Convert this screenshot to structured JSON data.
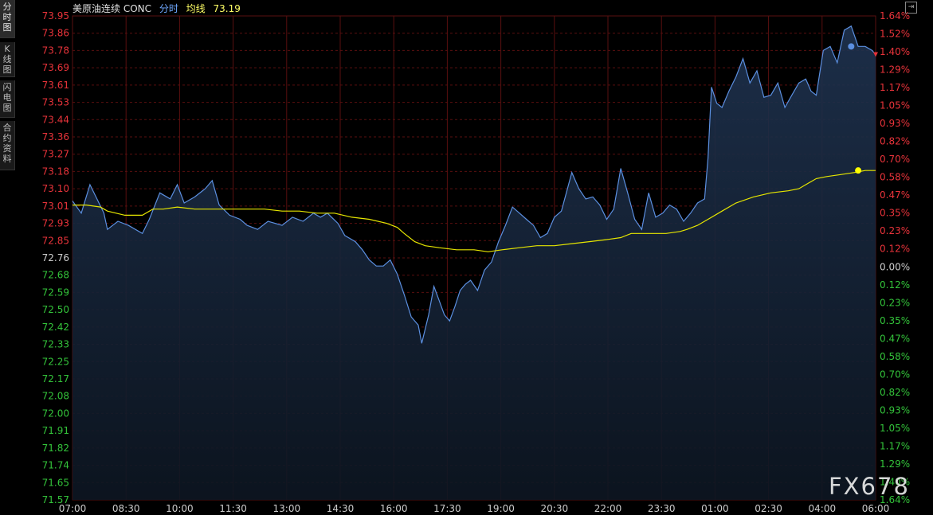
{
  "side_tabs": [
    {
      "label": "分时图",
      "active": true
    },
    {
      "label": "K线图",
      "active": false
    },
    {
      "label": "闪电图",
      "active": false
    },
    {
      "label": "合约资料",
      "active": false
    }
  ],
  "legend": {
    "name": "美原油连续 CONC",
    "minute_label": "分时",
    "avg_label": "均线",
    "avg_value": "73.19"
  },
  "corner_icon": "expand-icon",
  "watermark": "FX678",
  "colors": {
    "price_line": "#5b8fe0",
    "avg_line": "#e6e600",
    "up_label": "#e8333a",
    "down_label": "#33c33a",
    "grid": "#5a0f0f",
    "axis_text": "#cccccc"
  },
  "chart_data": {
    "type": "line",
    "title": "美原油连续 CONC",
    "xlabel": "",
    "ylabel": "",
    "x_unit": "hours since 07:00 (07:00 to next-day 06:00)",
    "xlim": [
      0,
      23
    ],
    "ylim": [
      71.57,
      73.95
    ],
    "reference_price": 72.76,
    "grid": true,
    "x_ticks": [
      "07:00",
      "08:30",
      "10:00",
      "11:30",
      "13:00",
      "14:30",
      "16:00",
      "17:30",
      "19:00",
      "20:30",
      "22:00",
      "23:30",
      "01:00",
      "02:30",
      "04:00",
      "06:00"
    ],
    "y_ticks_left": [
      "73.95",
      "73.86",
      "73.78",
      "73.69",
      "73.61",
      "73.53",
      "73.44",
      "73.36",
      "73.27",
      "73.18",
      "73.10",
      "73.01",
      "72.93",
      "72.85",
      "72.76",
      "72.68",
      "72.59",
      "72.50",
      "72.42",
      "72.33",
      "72.25",
      "72.17",
      "72.08",
      "72.00",
      "71.91",
      "71.82",
      "71.74",
      "71.65",
      "71.57"
    ],
    "y_ticks_right": [
      "1.64%",
      "1.52%",
      "1.40%",
      "1.29%",
      "1.17%",
      "1.05%",
      "0.93%",
      "0.82%",
      "0.70%",
      "0.58%",
      "0.47%",
      "0.35%",
      "0.23%",
      "0.12%",
      "0.00%",
      "0.12%",
      "0.23%",
      "0.35%",
      "0.47%",
      "0.58%",
      "0.70%",
      "0.82%",
      "0.93%",
      "1.05%",
      "1.17%",
      "1.29%",
      "1.40%",
      "1.64%"
    ],
    "series": [
      {
        "name": "分时",
        "points": [
          [
            0.0,
            73.04
          ],
          [
            0.25,
            72.98
          ],
          [
            0.5,
            73.12
          ],
          [
            0.7,
            73.05
          ],
          [
            0.9,
            72.98
          ],
          [
            1.0,
            72.9
          ],
          [
            1.3,
            72.94
          ],
          [
            1.6,
            72.92
          ],
          [
            2.0,
            72.88
          ],
          [
            2.2,
            72.95
          ],
          [
            2.5,
            73.08
          ],
          [
            2.8,
            73.05
          ],
          [
            3.0,
            73.12
          ],
          [
            3.2,
            73.03
          ],
          [
            3.5,
            73.06
          ],
          [
            3.8,
            73.1
          ],
          [
            4.0,
            73.14
          ],
          [
            4.2,
            73.02
          ],
          [
            4.5,
            72.97
          ],
          [
            4.8,
            72.95
          ],
          [
            5.0,
            72.92
          ],
          [
            5.3,
            72.9
          ],
          [
            5.6,
            72.94
          ],
          [
            6.0,
            72.92
          ],
          [
            6.3,
            72.96
          ],
          [
            6.6,
            72.94
          ],
          [
            6.9,
            72.98
          ],
          [
            7.1,
            72.96
          ],
          [
            7.3,
            72.98
          ],
          [
            7.6,
            72.93
          ],
          [
            7.8,
            72.87
          ],
          [
            8.1,
            72.84
          ],
          [
            8.3,
            72.8
          ],
          [
            8.5,
            72.75
          ],
          [
            8.7,
            72.72
          ],
          [
            8.9,
            72.72
          ],
          [
            9.1,
            72.75
          ],
          [
            9.3,
            72.68
          ],
          [
            9.5,
            72.58
          ],
          [
            9.7,
            72.47
          ],
          [
            9.9,
            72.43
          ],
          [
            10.0,
            72.34
          ],
          [
            10.2,
            72.48
          ],
          [
            10.35,
            72.62
          ],
          [
            10.5,
            72.55
          ],
          [
            10.65,
            72.48
          ],
          [
            10.8,
            72.45
          ],
          [
            10.95,
            72.52
          ],
          [
            11.1,
            72.6
          ],
          [
            11.25,
            72.63
          ],
          [
            11.4,
            72.65
          ],
          [
            11.6,
            72.6
          ],
          [
            11.8,
            72.7
          ],
          [
            12.0,
            72.74
          ],
          [
            12.2,
            72.84
          ],
          [
            12.4,
            72.92
          ],
          [
            12.6,
            73.01
          ],
          [
            12.8,
            72.98
          ],
          [
            13.0,
            72.95
          ],
          [
            13.2,
            72.92
          ],
          [
            13.4,
            72.86
          ],
          [
            13.6,
            72.88
          ],
          [
            13.8,
            72.96
          ],
          [
            14.0,
            72.99
          ],
          [
            14.3,
            73.18
          ],
          [
            14.5,
            73.1
          ],
          [
            14.7,
            73.05
          ],
          [
            14.9,
            73.06
          ],
          [
            15.1,
            73.02
          ],
          [
            15.3,
            72.95
          ],
          [
            15.5,
            73.0
          ],
          [
            15.7,
            73.2
          ],
          [
            15.9,
            73.08
          ],
          [
            16.1,
            72.95
          ],
          [
            16.3,
            72.9
          ],
          [
            16.5,
            73.08
          ],
          [
            16.7,
            72.96
          ],
          [
            16.9,
            72.98
          ],
          [
            17.1,
            73.02
          ],
          [
            17.3,
            73.0
          ],
          [
            17.5,
            72.94
          ],
          [
            17.7,
            72.98
          ],
          [
            17.9,
            73.03
          ],
          [
            18.1,
            73.05
          ],
          [
            18.2,
            73.25
          ],
          [
            18.3,
            73.6
          ],
          [
            18.45,
            73.52
          ],
          [
            18.6,
            73.5
          ],
          [
            18.8,
            73.58
          ],
          [
            19.0,
            73.65
          ],
          [
            19.2,
            73.74
          ],
          [
            19.4,
            73.62
          ],
          [
            19.6,
            73.68
          ],
          [
            19.8,
            73.55
          ],
          [
            20.0,
            73.56
          ],
          [
            20.2,
            73.62
          ],
          [
            20.4,
            73.5
          ],
          [
            20.6,
            73.56
          ],
          [
            20.8,
            73.62
          ],
          [
            21.0,
            73.64
          ],
          [
            21.15,
            73.58
          ],
          [
            21.3,
            73.56
          ],
          [
            21.5,
            73.78
          ],
          [
            21.7,
            73.8
          ],
          [
            21.9,
            73.72
          ],
          [
            22.1,
            73.88
          ],
          [
            22.3,
            73.9
          ],
          [
            22.5,
            73.8
          ],
          [
            22.7,
            73.8
          ],
          [
            22.9,
            73.78
          ],
          [
            23.0,
            73.76
          ]
        ]
      },
      {
        "name": "均线",
        "points": [
          [
            0.0,
            73.02
          ],
          [
            0.4,
            73.02
          ],
          [
            0.8,
            73.01
          ],
          [
            1.0,
            72.99
          ],
          [
            1.5,
            72.97
          ],
          [
            2.0,
            72.97
          ],
          [
            2.3,
            73.0
          ],
          [
            2.6,
            73.0
          ],
          [
            3.0,
            73.01
          ],
          [
            3.5,
            73.0
          ],
          [
            4.0,
            73.0
          ],
          [
            4.5,
            73.0
          ],
          [
            5.0,
            73.0
          ],
          [
            5.5,
            73.0
          ],
          [
            6.0,
            72.99
          ],
          [
            6.5,
            72.99
          ],
          [
            7.0,
            72.98
          ],
          [
            7.5,
            72.98
          ],
          [
            8.0,
            72.96
          ],
          [
            8.5,
            72.95
          ],
          [
            9.0,
            72.93
          ],
          [
            9.3,
            72.91
          ],
          [
            9.5,
            72.88
          ],
          [
            9.8,
            72.84
          ],
          [
            10.1,
            72.82
          ],
          [
            10.5,
            72.81
          ],
          [
            11.0,
            72.8
          ],
          [
            11.5,
            72.8
          ],
          [
            11.9,
            72.79
          ],
          [
            12.3,
            72.8
          ],
          [
            12.8,
            72.81
          ],
          [
            13.3,
            72.82
          ],
          [
            13.8,
            72.82
          ],
          [
            14.3,
            72.83
          ],
          [
            14.8,
            72.84
          ],
          [
            15.3,
            72.85
          ],
          [
            15.7,
            72.86
          ],
          [
            16.0,
            72.88
          ],
          [
            16.5,
            72.88
          ],
          [
            17.0,
            72.88
          ],
          [
            17.4,
            72.89
          ],
          [
            17.6,
            72.9
          ],
          [
            17.9,
            72.92
          ],
          [
            18.2,
            72.95
          ],
          [
            18.6,
            72.99
          ],
          [
            19.0,
            73.03
          ],
          [
            19.5,
            73.06
          ],
          [
            20.0,
            73.08
          ],
          [
            20.5,
            73.09
          ],
          [
            20.8,
            73.1
          ],
          [
            21.0,
            73.12
          ],
          [
            21.3,
            73.15
          ],
          [
            21.6,
            73.16
          ],
          [
            22.0,
            73.17
          ],
          [
            22.4,
            73.18
          ],
          [
            22.7,
            73.19
          ],
          [
            23.0,
            73.19
          ]
        ]
      }
    ],
    "markers": [
      {
        "series": "均线",
        "x": 22.5,
        "y": 73.19,
        "color": "#ffff00"
      },
      {
        "series": "分时",
        "x": 22.3,
        "y": 73.8,
        "color": "#5b8fe0"
      },
      {
        "series": "last",
        "x": 23.0,
        "y": 73.76,
        "color": "#e8333a"
      }
    ]
  }
}
